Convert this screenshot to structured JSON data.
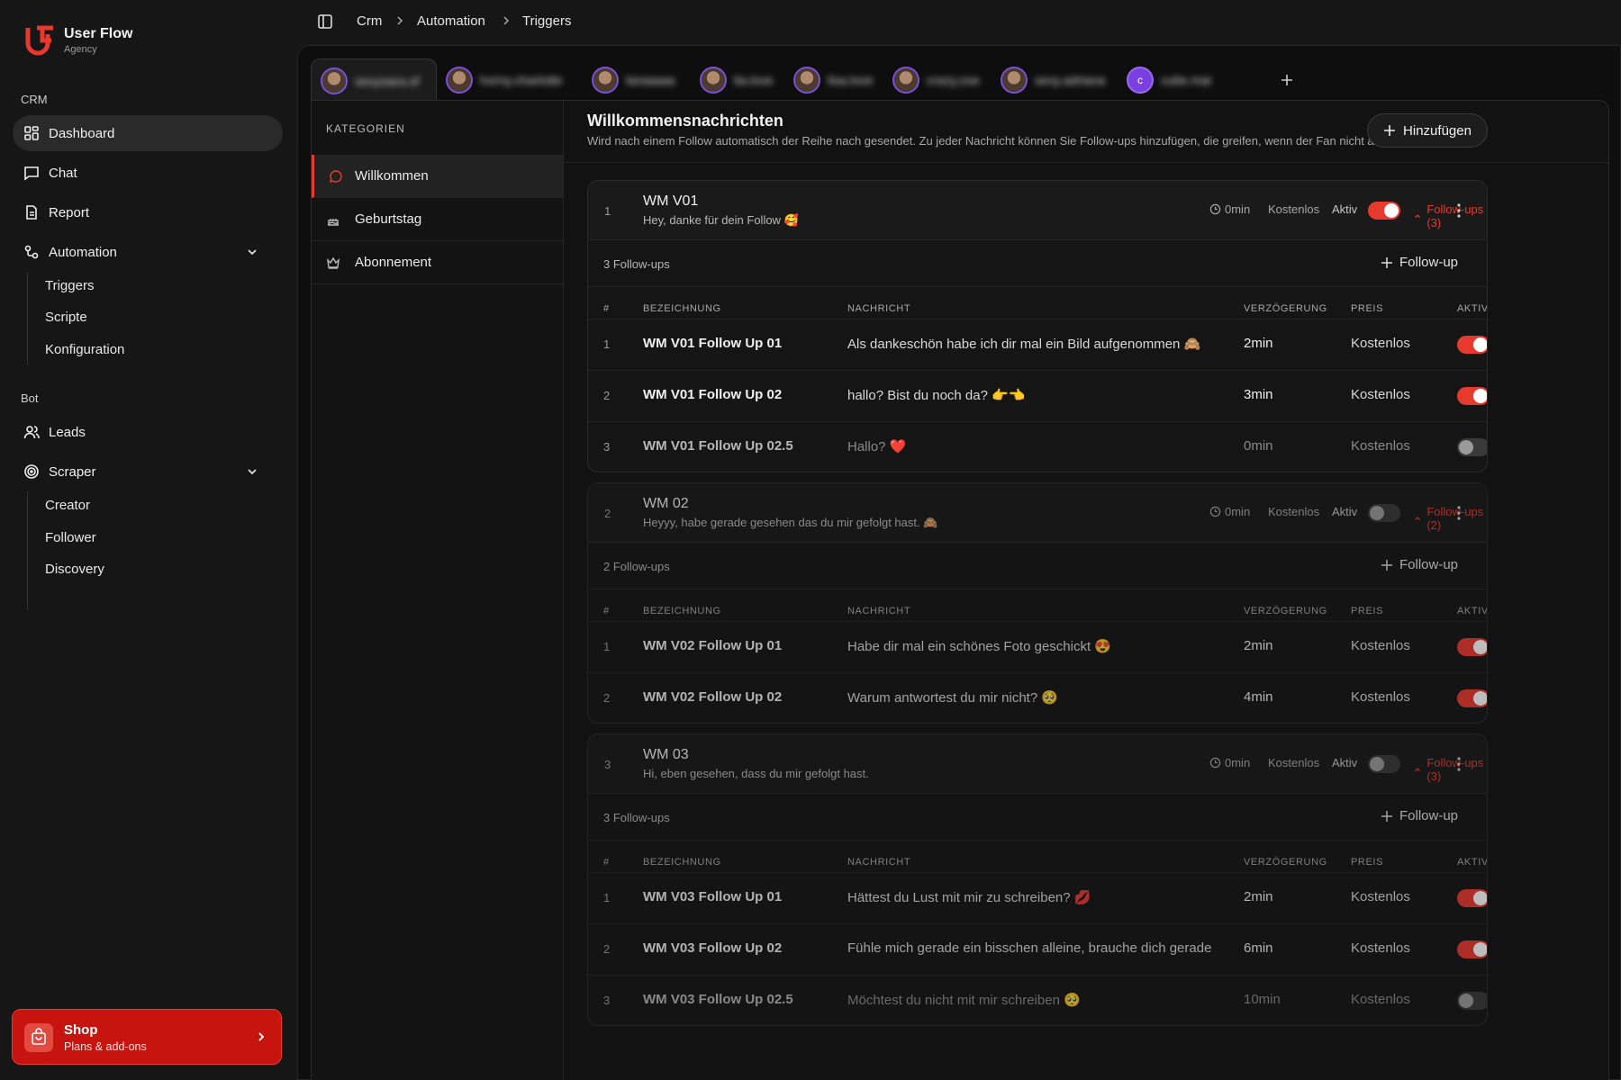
{
  "app": {
    "name": "User Flow",
    "subtitle": "Agency"
  },
  "breadcrumb": [
    "Crm",
    "Automation",
    "Triggers"
  ],
  "sidebar": {
    "sections": [
      {
        "label": "CRM"
      },
      {
        "label": "Bot"
      }
    ],
    "items": {
      "dashboard": "Dashboard",
      "chat": "Chat",
      "report": "Report",
      "automation": "Automation",
      "leads": "Leads",
      "scraper": "Scraper"
    },
    "automation_sub": [
      "Triggers",
      "Scripte",
      "Konfiguration"
    ],
    "scraper_sub": [
      "Creator",
      "Follower",
      "Discovery"
    ]
  },
  "shop": {
    "title": "Shop",
    "subtitle": "Plans & add-ons"
  },
  "tabs": [
    {
      "label": "sexysara.of",
      "active": true
    },
    {
      "label": "horny.charlotte"
    },
    {
      "label": "laraaaaa"
    },
    {
      "label": "lia.love"
    },
    {
      "label": "lisa.love"
    },
    {
      "label": "crazy.zoe"
    },
    {
      "label": "sexy.adriana"
    },
    {
      "label": "cutie.mai",
      "initial": "c"
    }
  ],
  "categories": {
    "heading": "KATEGORIEN",
    "items": [
      "Willkommen",
      "Geburtstag",
      "Abonnement"
    ],
    "active": "Willkommen"
  },
  "main": {
    "title": "Willkommensnachrichten",
    "subtitle": "Wird nach einem Follow automatisch der Reihe nach gesendet. Zu jeder Nachricht können Sie Follow-ups hinzufügen, die greifen, wenn der Fan nicht antwortet.",
    "add_label": "Hinzufügen"
  },
  "table_headers": {
    "num": "#",
    "name": "BEZEICHNUNG",
    "message": "NACHRICHT",
    "delay": "VERZÖGERUNG",
    "price": "PREIS",
    "active": "AKTIV"
  },
  "followup_button": "Follow-up",
  "messages": [
    {
      "num": "1",
      "title": "WM V01",
      "text": "Hey, danke für dein Follow 🥰",
      "delay": "0min",
      "price": "Kostenlos",
      "aktiv_label": "Aktiv",
      "active": true,
      "followups_label": "Follow-ups (3)",
      "followups_count": "3 Follow-ups",
      "followups": [
        {
          "num": "1",
          "name": "WM V01 Follow Up 01",
          "message": "Als dankeschön habe ich dir mal ein Bild aufgenommen 🙈",
          "delay": "2min",
          "price": "Kostenlos",
          "active": true
        },
        {
          "num": "2",
          "name": "WM V01 Follow Up 02",
          "message": "hallo? Bist du noch da? 👉👈",
          "delay": "3min",
          "price": "Kostenlos",
          "active": true
        },
        {
          "num": "3",
          "name": "WM V01 Follow Up 02.5",
          "message": "Hallo? ❤️",
          "delay": "0min",
          "price": "Kostenlos",
          "active": false
        }
      ]
    },
    {
      "num": "2",
      "title": "WM 02",
      "text": "Heyyy, habe gerade gesehen das du mir gefolgt hast. 🙈",
      "delay": "0min",
      "price": "Kostenlos",
      "aktiv_label": "Aktiv",
      "active": false,
      "followups_label": "Follow-ups (2)",
      "followups_count": "2 Follow-ups",
      "followups": [
        {
          "num": "1",
          "name": "WM V02 Follow Up 01",
          "message": "Habe dir mal ein schönes Foto geschickt 😍",
          "delay": "2min",
          "price": "Kostenlos",
          "active": true
        },
        {
          "num": "2",
          "name": "WM V02 Follow Up 02",
          "message": "Warum antwortest du mir nicht? 🥺",
          "delay": "4min",
          "price": "Kostenlos",
          "active": true
        }
      ]
    },
    {
      "num": "3",
      "title": "WM 03",
      "text": "Hi, eben gesehen, dass du mir gefolgt hast.",
      "delay": "0min",
      "price": "Kostenlos",
      "aktiv_label": "Aktiv",
      "active": false,
      "followups_label": "Follow-ups (3)",
      "followups_count": "3 Follow-ups",
      "followups": [
        {
          "num": "1",
          "name": "WM V03 Follow Up 01",
          "message": "Hättest du Lust mit mir zu schreiben? 💋",
          "delay": "2min",
          "price": "Kostenlos",
          "active": true
        },
        {
          "num": "2",
          "name": "WM V03 Follow Up 02",
          "message": "Fühle mich gerade ein bisschen alleine, brauche dich gerade",
          "delay": "6min",
          "price": "Kostenlos",
          "active": true
        },
        {
          "num": "3",
          "name": "WM V03 Follow Up 02.5",
          "message": "Möchtest du nicht mit mir schreiben 🥺",
          "delay": "10min",
          "price": "Kostenlos",
          "active": false
        }
      ]
    }
  ],
  "colors": {
    "accent": "#e8392f",
    "background": "#161616",
    "panel": "#121212"
  }
}
